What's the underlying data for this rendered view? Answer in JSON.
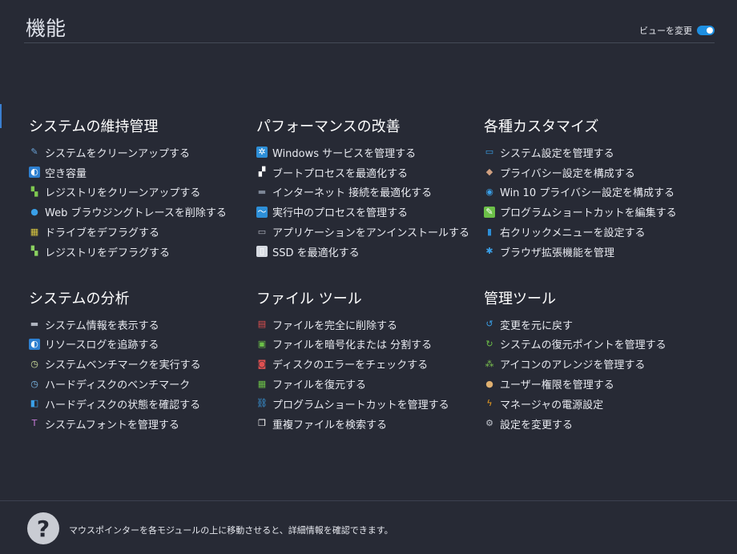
{
  "header": {
    "title": "機能",
    "view_change_label": "ビューを変更"
  },
  "colors": {
    "background": "#272a35",
    "accent": "#1e8fe1"
  },
  "sections": [
    {
      "title": "システムの維持管理",
      "items": [
        {
          "label": "システムをクリーンアップする",
          "icon": "broom-icon",
          "glyph": "✎",
          "color": "#6aa3d8",
          "bg": "transparent"
        },
        {
          "label": "空き容量",
          "icon": "disk-space-icon",
          "glyph": "◐",
          "color": "#ffffff",
          "bg": "#2d7fd0"
        },
        {
          "label": "レジストリをクリーンアップする",
          "icon": "registry-clean-icon",
          "glyph": "▚",
          "color": "#7ec850",
          "bg": "transparent"
        },
        {
          "label": "Web ブラウジングトレースを削除する",
          "icon": "globe-icon",
          "glyph": "●",
          "color": "#3aa0e8",
          "bg": "transparent"
        },
        {
          "label": "ドライブをデフラグする",
          "icon": "defrag-drive-icon",
          "glyph": "▦",
          "color": "#d8c640",
          "bg": "transparent"
        },
        {
          "label": "レジストリをデフラグする",
          "icon": "registry-defrag-icon",
          "glyph": "▚",
          "color": "#8ad060",
          "bg": "transparent"
        }
      ]
    },
    {
      "title": "パフォーマンスの改善",
      "items": [
        {
          "label": "Windows サービスを管理する",
          "icon": "windows-services-icon",
          "glyph": "✲",
          "color": "#ffffff",
          "bg": "#2d8fd8"
        },
        {
          "label": "ブートプロセスを最適化する",
          "icon": "boot-process-icon",
          "glyph": "▞",
          "color": "#ffffff",
          "bg": "transparent"
        },
        {
          "label": "インターネット 接続を最適化する",
          "icon": "network-icon",
          "glyph": "▬",
          "color": "#7d8696",
          "bg": "transparent"
        },
        {
          "label": "実行中のプロセスを管理する",
          "icon": "process-chart-icon",
          "glyph": "〜",
          "color": "#ffffff",
          "bg": "#2d8fd8"
        },
        {
          "label": "アプリケーションをアンインストールする",
          "icon": "uninstall-icon",
          "glyph": "▭",
          "color": "#b0b5c0",
          "bg": "transparent"
        },
        {
          "label": "SSD を最適化する",
          "icon": "ssd-icon",
          "glyph": "▯",
          "color": "#ffffff",
          "bg": "#d7dbe2"
        }
      ]
    },
    {
      "title": "各種カスタマイズ",
      "items": [
        {
          "label": "システム設定を管理する",
          "icon": "monitor-icon",
          "glyph": "▭",
          "color": "#3aa0e8",
          "bg": "transparent"
        },
        {
          "label": "プライバシー設定を構成する",
          "icon": "privacy-icon",
          "glyph": "◆",
          "color": "#d0a080",
          "bg": "transparent"
        },
        {
          "label": "Win 10 プライバシー設定を構成する",
          "icon": "eye-icon",
          "glyph": "◉",
          "color": "#3aa0e8",
          "bg": "transparent"
        },
        {
          "label": "プログラムショートカットを編集する",
          "icon": "shortcut-edit-icon",
          "glyph": "✎",
          "color": "#ffffff",
          "bg": "#6cc048"
        },
        {
          "label": "右クリックメニューを設定する",
          "icon": "context-menu-icon",
          "glyph": "▮",
          "color": "#2d8fd8",
          "bg": "transparent"
        },
        {
          "label": "ブラウザ拡張機能を管理",
          "icon": "puzzle-icon",
          "glyph": "✱",
          "color": "#3aa0e8",
          "bg": "transparent"
        }
      ]
    },
    {
      "title": "システムの分析",
      "items": [
        {
          "label": "システム情報を表示する",
          "icon": "laptop-icon",
          "glyph": "▬",
          "color": "#b0b5c0",
          "bg": "transparent"
        },
        {
          "label": "リソースログを追跡する",
          "icon": "resource-log-icon",
          "glyph": "◐",
          "color": "#ffffff",
          "bg": "#2d7fd0"
        },
        {
          "label": "システムベンチマークを実行する",
          "icon": "stopwatch-icon",
          "glyph": "◷",
          "color": "#d8e8a0",
          "bg": "transparent"
        },
        {
          "label": "ハードディスクのベンチマーク",
          "icon": "disk-benchmark-icon",
          "glyph": "◷",
          "color": "#80c0f0",
          "bg": "transparent"
        },
        {
          "label": "ハードディスクの状態を確認する",
          "icon": "disk-health-icon",
          "glyph": "◧",
          "color": "#3aa0e8",
          "bg": "transparent"
        },
        {
          "label": "システムフォントを管理する",
          "icon": "font-icon",
          "glyph": "T",
          "color": "#c77ad8",
          "bg": "transparent"
        }
      ]
    },
    {
      "title": "ファイル ツール",
      "items": [
        {
          "label": "ファイルを完全に削除する",
          "icon": "shredder-icon",
          "glyph": "▤",
          "color": "#e05050",
          "bg": "transparent"
        },
        {
          "label": "ファイルを暗号化または 分割する",
          "icon": "lock-file-icon",
          "glyph": "▣",
          "color": "#6cc048",
          "bg": "transparent"
        },
        {
          "label": "ディスクのエラーをチェックする",
          "icon": "disk-check-icon",
          "glyph": "◙",
          "color": "#e05050",
          "bg": "transparent"
        },
        {
          "label": "ファイルを復元する",
          "icon": "file-restore-icon",
          "glyph": "▦",
          "color": "#6cc048",
          "bg": "transparent"
        },
        {
          "label": "プログラムショートカットを管理する",
          "icon": "link-icon",
          "glyph": "⛓",
          "color": "#3aa0e8",
          "bg": "transparent"
        },
        {
          "label": "重複ファイルを検索する",
          "icon": "duplicate-files-icon",
          "glyph": "❐",
          "color": "#ffffff",
          "bg": "transparent"
        }
      ]
    },
    {
      "title": "管理ツール",
      "items": [
        {
          "label": "変更を元に戻す",
          "icon": "undo-icon",
          "glyph": "↺",
          "color": "#3aa0e8",
          "bg": "transparent"
        },
        {
          "label": "システムの復元ポイントを管理する",
          "icon": "restore-point-icon",
          "glyph": "↻",
          "color": "#6cc048",
          "bg": "transparent"
        },
        {
          "label": "アイコンのアレンジを管理する",
          "icon": "icon-arrange-icon",
          "glyph": "⁂",
          "color": "#7ec850",
          "bg": "transparent"
        },
        {
          "label": "ユーザー権限を管理する",
          "icon": "user-icon",
          "glyph": "●",
          "color": "#e0b070",
          "bg": "transparent"
        },
        {
          "label": "マネージャの電源設定",
          "icon": "power-icon",
          "glyph": "ϟ",
          "color": "#f0a020",
          "bg": "transparent"
        },
        {
          "label": "設定を変更する",
          "icon": "gear-icon",
          "glyph": "⚙",
          "color": "#c0c4cc",
          "bg": "transparent"
        }
      ]
    }
  ],
  "footer": {
    "help_glyph": "?",
    "text": "マウスポインターを各モジュールの上に移動させると、詳細情報を確認できます。"
  }
}
